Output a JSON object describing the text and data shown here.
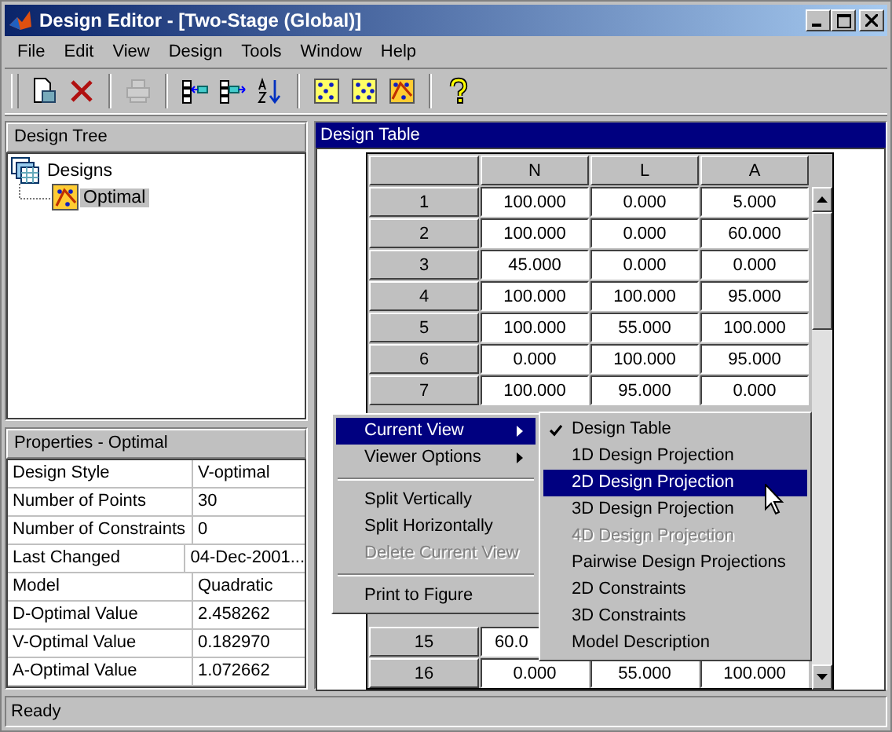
{
  "window": {
    "title": "Design Editor - [Two-Stage (Global)]"
  },
  "menu": [
    "File",
    "Edit",
    "View",
    "Design",
    "Tools",
    "Window",
    "Help"
  ],
  "toolbar": [
    {
      "kind": "new",
      "disabled": false
    },
    {
      "kind": "delete",
      "disabled": false
    },
    {
      "kind": "sep"
    },
    {
      "kind": "print",
      "disabled": true
    },
    {
      "kind": "sep"
    },
    {
      "kind": "split-left",
      "disabled": false
    },
    {
      "kind": "split-right",
      "disabled": false
    },
    {
      "kind": "sort",
      "disabled": false
    },
    {
      "kind": "sep"
    },
    {
      "kind": "design-a",
      "disabled": false
    },
    {
      "kind": "design-b",
      "disabled": false
    },
    {
      "kind": "design-c",
      "disabled": false
    },
    {
      "kind": "sep"
    },
    {
      "kind": "help",
      "disabled": false
    }
  ],
  "design_tree": {
    "title": "Design Tree",
    "items": [
      {
        "label": "Designs",
        "selected": false,
        "children": [
          {
            "label": "Optimal",
            "selected": true
          }
        ]
      }
    ]
  },
  "properties": {
    "title": "Properties - Optimal",
    "rows": [
      {
        "name": "Design Style",
        "value": "V-optimal"
      },
      {
        "name": "Number of Points",
        "value": "30"
      },
      {
        "name": "Number of Constraints",
        "value": "0"
      },
      {
        "name": "Last Changed",
        "value": "04-Dec-2001..."
      },
      {
        "name": "Model",
        "value": "Quadratic"
      },
      {
        "name": "D-Optimal Value",
        "value": "2.458262"
      },
      {
        "name": "V-Optimal Value",
        "value": "0.182970"
      },
      {
        "name": "A-Optimal Value",
        "value": "1.072662"
      }
    ]
  },
  "design_table": {
    "title": "Design Table",
    "columns": [
      "N",
      "L",
      "A"
    ],
    "rows": [
      {
        "label": "1",
        "cells": [
          "100.000",
          "0.000",
          "5.000"
        ]
      },
      {
        "label": "2",
        "cells": [
          "100.000",
          "0.000",
          "60.000"
        ]
      },
      {
        "label": "3",
        "cells": [
          "45.000",
          "0.000",
          "0.000"
        ]
      },
      {
        "label": "4",
        "cells": [
          "100.000",
          "100.000",
          "95.000"
        ]
      },
      {
        "label": "5",
        "cells": [
          "100.000",
          "55.000",
          "100.000"
        ]
      },
      {
        "label": "6",
        "cells": [
          "0.000",
          "100.000",
          "95.000"
        ]
      },
      {
        "label": "7",
        "cells": [
          "100.000",
          "95.000",
          "0.000"
        ]
      }
    ],
    "lower_rows": [
      {
        "label": "15",
        "cells": [
          "60.0"
        ]
      },
      {
        "label": "16",
        "cells": [
          "0.000",
          "55.000",
          "100.000"
        ]
      }
    ]
  },
  "context_menu": {
    "items": [
      {
        "kind": "submenu",
        "label": "Current View",
        "selected": true
      },
      {
        "kind": "submenu",
        "label": "Viewer Options",
        "selected": false
      },
      {
        "kind": "separator"
      },
      {
        "kind": "item",
        "label": "Split Vertically",
        "disabled": false
      },
      {
        "kind": "item",
        "label": "Split Horizontally",
        "disabled": false
      },
      {
        "kind": "item",
        "label": "Delete Current View",
        "disabled": true
      },
      {
        "kind": "separator"
      },
      {
        "kind": "item",
        "label": "Print to Figure",
        "disabled": false
      }
    ]
  },
  "submenu": {
    "items": [
      {
        "label": "Design Table",
        "checked": true,
        "selected": false,
        "disabled": false
      },
      {
        "label": "1D Design Projection",
        "checked": false,
        "selected": false,
        "disabled": false
      },
      {
        "label": "2D Design Projection",
        "checked": false,
        "selected": true,
        "disabled": false
      },
      {
        "label": "3D Design Projection",
        "checked": false,
        "selected": false,
        "disabled": false
      },
      {
        "label": "4D Design Projection",
        "checked": false,
        "selected": false,
        "disabled": true
      },
      {
        "label": "Pairwise Design Projections",
        "checked": false,
        "selected": false,
        "disabled": false
      },
      {
        "label": "2D Constraints",
        "checked": false,
        "selected": false,
        "disabled": false
      },
      {
        "label": "3D Constraints",
        "checked": false,
        "selected": false,
        "disabled": false
      },
      {
        "label": "Model Description",
        "checked": false,
        "selected": false,
        "disabled": false
      }
    ]
  },
  "status_bar": "Ready"
}
